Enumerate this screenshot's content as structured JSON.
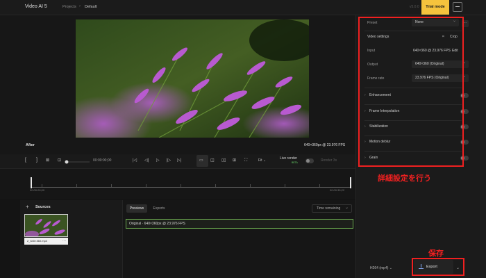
{
  "app": {
    "title": "Video AI 5",
    "breadcrumb": [
      "Projects",
      "Default"
    ],
    "breadcrumb_sep": "›",
    "version": "v5.0.0",
    "trial_button": "Trial mode"
  },
  "preview": {
    "after_label": "After",
    "resolution_label": "640×360px @ 23.976 FPS"
  },
  "controls": {
    "timecode": "00:00:00;00",
    "zoom": "Fit ⌄",
    "live_render_label": "Live render",
    "live_render_badge": "BETA",
    "render_label": "Render 3s"
  },
  "timeline": {
    "start": "00:00:00;00",
    "end": "00:00:35;22"
  },
  "sources": {
    "title": "Sources",
    "file_name": "2_640×360.mp4"
  },
  "exports_panel": {
    "tabs": [
      "Previews",
      "Exports"
    ],
    "sort_label": "Time remaining",
    "rows": [
      "Original · 640×360px @ 23.976 FPS"
    ]
  },
  "settings": {
    "preset_label": "Preset",
    "preset_value": "None",
    "video_settings_label": "Video settings",
    "crop_label": "Crop",
    "input_label": "Input",
    "input_value": "640×360 @ 23.976 FPS",
    "edit_label": "Edit",
    "output_label": "Output",
    "output_value": "640×360 (Original)",
    "frame_rate_label": "Frame rate",
    "frame_rate_value": "23.976 FPS (Original)",
    "sections": [
      "Enhancement",
      "Frame Interpolation",
      "Stabilization",
      "Motion deblur",
      "Grain"
    ],
    "format": "H264 (mp4) ⌄",
    "export_label": "Export"
  },
  "annotations": {
    "advanced": "詳細設定を行う",
    "save": "保存"
  },
  "colors": {
    "accent_yellow": "#f6c33d",
    "annotation_red": "#f02020",
    "selection_green": "#6aa84f"
  }
}
